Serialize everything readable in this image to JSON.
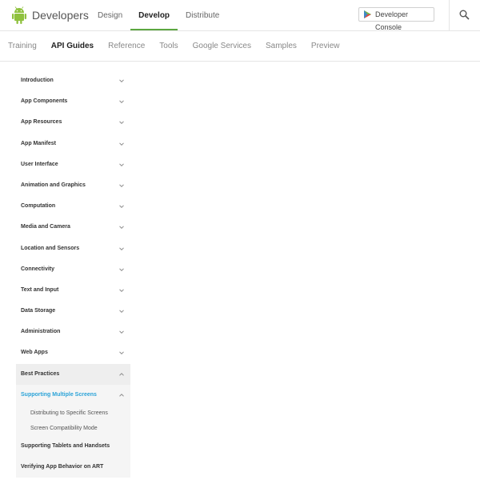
{
  "header": {
    "brand": "Developers",
    "tabs": [
      {
        "label": "Design",
        "active": false
      },
      {
        "label": "Develop",
        "active": true
      },
      {
        "label": "Distribute",
        "active": false
      }
    ],
    "console_label": "Developer Console",
    "accent_color": "#5ca740"
  },
  "subnav": {
    "items": [
      {
        "label": "Training",
        "active": false
      },
      {
        "label": "API Guides",
        "active": true
      },
      {
        "label": "Reference",
        "active": false
      },
      {
        "label": "Tools",
        "active": false
      },
      {
        "label": "Google Services",
        "active": false
      },
      {
        "label": "Samples",
        "active": false
      },
      {
        "label": "Preview",
        "active": false
      }
    ]
  },
  "sidebar": {
    "items": [
      "Introduction",
      "App Components",
      "App Resources",
      "App Manifest",
      "User Interface",
      "Animation and Graphics",
      "Computation",
      "Media and Camera",
      "Location and Sensors",
      "Connectivity",
      "Text and Input",
      "Data Storage",
      "Administration",
      "Web Apps"
    ],
    "best_practices": {
      "label": "Best Practices",
      "open_section": {
        "label": "Supporting Multiple Screens",
        "color": "#2ba3d8",
        "children": [
          "Distributing to Specific Screens",
          "Screen Compatibility Mode"
        ]
      },
      "following": [
        "Supporting Tablets and Handsets",
        "Verifying App Behavior on ART"
      ]
    }
  }
}
